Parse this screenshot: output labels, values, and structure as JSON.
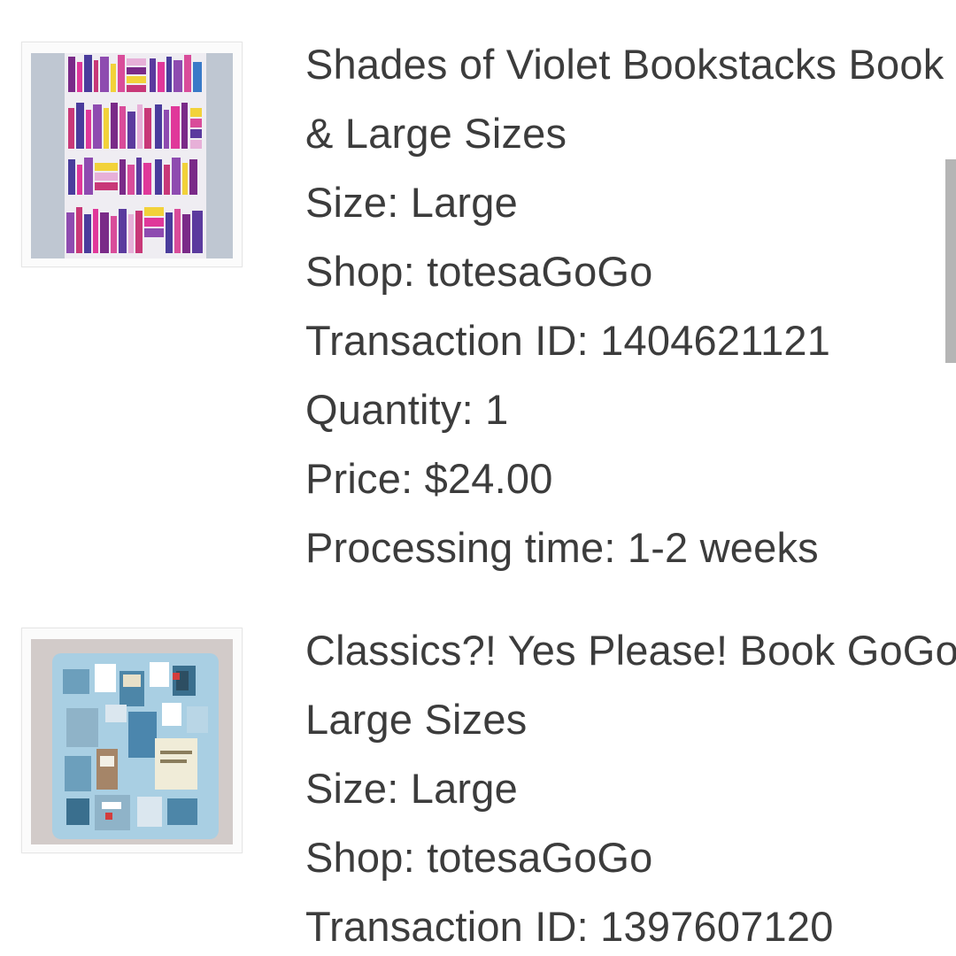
{
  "orders": [
    {
      "title_line1": "Shades of Violet Bookstacks Book GoGo - Small, Medium",
      "title_line2": "& Large Sizes",
      "size": "Size: Large",
      "shop": "Shop: totesaGoGo",
      "transaction": "Transaction ID: 1404621121",
      "quantity": "Quantity: 1",
      "price": "Price: $24.00",
      "processing": "Processing time: 1-2 weeks"
    },
    {
      "title_line1": "Classics?! Yes Please! Book GoGo - Small, Medium &",
      "title_line2": "Large Sizes",
      "size": "Size: Large",
      "shop": "Shop: totesaGoGo",
      "transaction": "Transaction ID: 1397607120"
    }
  ],
  "colors": {
    "text": "#3c3c3c",
    "scrollbar": "#b5b5b5",
    "thumb_border": "#e6e6e6"
  }
}
